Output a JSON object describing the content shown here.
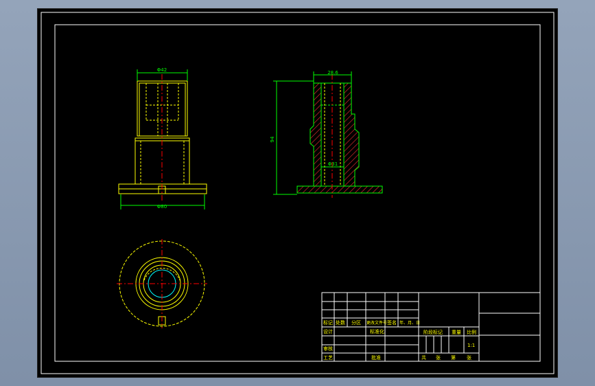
{
  "colors": {
    "frame": "#ffffff",
    "part": "#ffff00",
    "dimension": "#00ff00",
    "centerline": "#ff0000",
    "hatch": "#ff3333",
    "background": "#000000"
  },
  "dimensions": {
    "top_width": "Φ42",
    "base_width": "Φ80",
    "section_width": "28.6",
    "height": "94",
    "bore": "Φ31"
  },
  "title_block": {
    "row_headers": [
      "标记",
      "处数",
      "分区",
      "更改文件号",
      "签名",
      "年、月、日"
    ],
    "design": "设计",
    "standardization": "标准化",
    "review": "审核",
    "process": "工艺",
    "approve": "批准",
    "stage_mark": "阶段标记",
    "weight": "重量",
    "scale": "比例",
    "scale_value": "1:1",
    "sheets_total": "共",
    "sheets_word": "张",
    "sheet_no": "第",
    "sheet_word": "张"
  }
}
